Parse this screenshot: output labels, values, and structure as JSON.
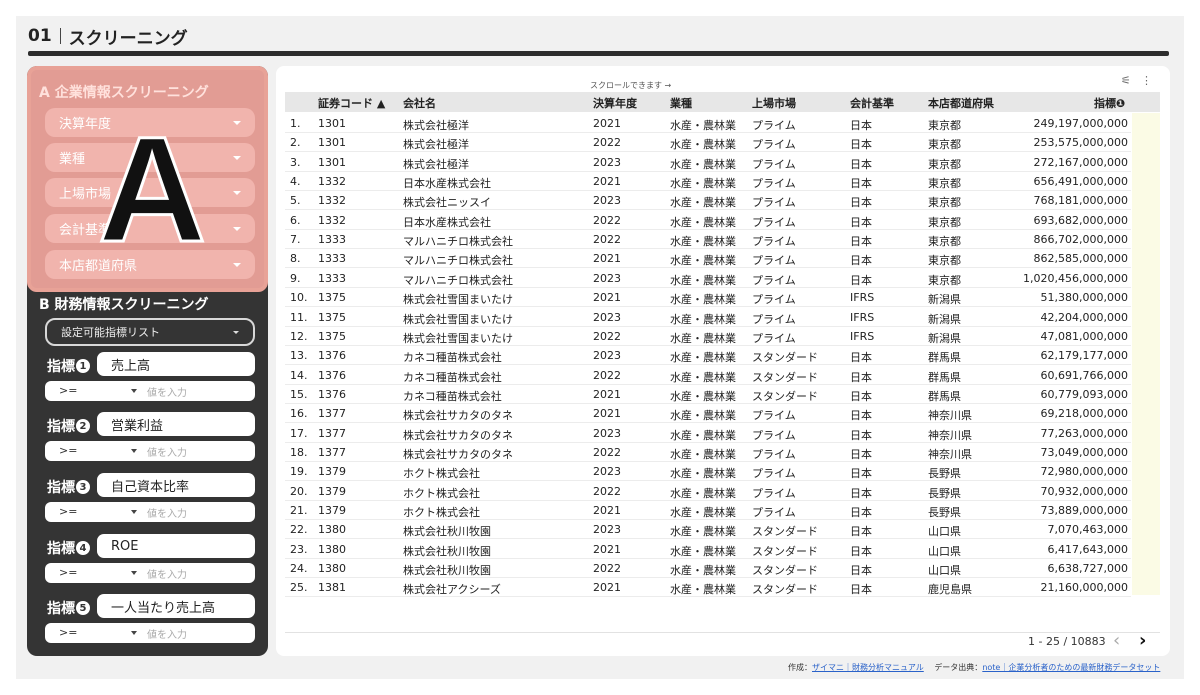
{
  "header": {
    "number": "01",
    "title": "スクリーニング"
  },
  "section_a": {
    "title": "A 企業情報スクリーニング",
    "filters": [
      "決算年度",
      "業種",
      "上場市場",
      "会計基準",
      "本店都道府県"
    ],
    "overlay_letter": "A"
  },
  "section_b": {
    "title": "B 財務情報スクリーニング",
    "list_label": "設定可能指標リスト",
    "metric_prefix": "指標",
    "metrics": [
      {
        "num": "1",
        "name": "売上高",
        "op": ">=",
        "placeholder": "値を入力"
      },
      {
        "num": "2",
        "name": "営業利益",
        "op": ">=",
        "placeholder": "値を入力"
      },
      {
        "num": "3",
        "name": "自己資本比率",
        "op": ">=",
        "placeholder": "値を入力"
      },
      {
        "num": "4",
        "name": "ROE",
        "op": ">=",
        "placeholder": "値を入力"
      },
      {
        "num": "5",
        "name": "一人当たり売上高",
        "op": ">=",
        "placeholder": "値を入力"
      }
    ]
  },
  "table": {
    "scroll_hint": "スクロールできます →",
    "toolbar": {
      "filter_icon": "filter-settings-icon",
      "more_icon": "more-vert-icon"
    },
    "columns": {
      "code": "証券コード ▲",
      "company": "会社名",
      "year": "決算年度",
      "industry": "業種",
      "market": "上場市場",
      "standard": "会計基準",
      "prefecture": "本店都道府県",
      "metric": "指標❶"
    },
    "rows": [
      [
        "1.",
        "1301",
        "株式会社極洋",
        "2021",
        "水産・農林業",
        "プライム",
        "日本",
        "東京都",
        "249,197,000,000"
      ],
      [
        "2.",
        "1301",
        "株式会社極洋",
        "2022",
        "水産・農林業",
        "プライム",
        "日本",
        "東京都",
        "253,575,000,000"
      ],
      [
        "3.",
        "1301",
        "株式会社極洋",
        "2023",
        "水産・農林業",
        "プライム",
        "日本",
        "東京都",
        "272,167,000,000"
      ],
      [
        "4.",
        "1332",
        "日本水産株式会社",
        "2021",
        "水産・農林業",
        "プライム",
        "日本",
        "東京都",
        "656,491,000,000"
      ],
      [
        "5.",
        "1332",
        "株式会社ニッスイ",
        "2023",
        "水産・農林業",
        "プライム",
        "日本",
        "東京都",
        "768,181,000,000"
      ],
      [
        "6.",
        "1332",
        "日本水産株式会社",
        "2022",
        "水産・農林業",
        "プライム",
        "日本",
        "東京都",
        "693,682,000,000"
      ],
      [
        "7.",
        "1333",
        "マルハニチロ株式会社",
        "2022",
        "水産・農林業",
        "プライム",
        "日本",
        "東京都",
        "866,702,000,000"
      ],
      [
        "8.",
        "1333",
        "マルハニチロ株式会社",
        "2021",
        "水産・農林業",
        "プライム",
        "日本",
        "東京都",
        "862,585,000,000"
      ],
      [
        "9.",
        "1333",
        "マルハニチロ株式会社",
        "2023",
        "水産・農林業",
        "プライム",
        "日本",
        "東京都",
        "1,020,456,000,000"
      ],
      [
        "10.",
        "1375",
        "株式会社雪国まいたけ",
        "2021",
        "水産・農林業",
        "プライム",
        "IFRS",
        "新潟県",
        "51,380,000,000"
      ],
      [
        "11.",
        "1375",
        "株式会社雪国まいたけ",
        "2023",
        "水産・農林業",
        "プライム",
        "IFRS",
        "新潟県",
        "42,204,000,000"
      ],
      [
        "12.",
        "1375",
        "株式会社雪国まいたけ",
        "2022",
        "水産・農林業",
        "プライム",
        "IFRS",
        "新潟県",
        "47,081,000,000"
      ],
      [
        "13.",
        "1376",
        "カネコ種苗株式会社",
        "2023",
        "水産・農林業",
        "スタンダード",
        "日本",
        "群馬県",
        "62,179,177,000"
      ],
      [
        "14.",
        "1376",
        "カネコ種苗株式会社",
        "2022",
        "水産・農林業",
        "スタンダード",
        "日本",
        "群馬県",
        "60,691,766,000"
      ],
      [
        "15.",
        "1376",
        "カネコ種苗株式会社",
        "2021",
        "水産・農林業",
        "スタンダード",
        "日本",
        "群馬県",
        "60,779,093,000"
      ],
      [
        "16.",
        "1377",
        "株式会社サカタのタネ",
        "2021",
        "水産・農林業",
        "プライム",
        "日本",
        "神奈川県",
        "69,218,000,000"
      ],
      [
        "17.",
        "1377",
        "株式会社サカタのタネ",
        "2023",
        "水産・農林業",
        "プライム",
        "日本",
        "神奈川県",
        "77,263,000,000"
      ],
      [
        "18.",
        "1377",
        "株式会社サカタのタネ",
        "2022",
        "水産・農林業",
        "プライム",
        "日本",
        "神奈川県",
        "73,049,000,000"
      ],
      [
        "19.",
        "1379",
        "ホクト株式会社",
        "2023",
        "水産・農林業",
        "プライム",
        "日本",
        "長野県",
        "72,980,000,000"
      ],
      [
        "20.",
        "1379",
        "ホクト株式会社",
        "2022",
        "水産・農林業",
        "プライム",
        "日本",
        "長野県",
        "70,932,000,000"
      ],
      [
        "21.",
        "1379",
        "ホクト株式会社",
        "2021",
        "水産・農林業",
        "プライム",
        "日本",
        "長野県",
        "73,889,000,000"
      ],
      [
        "22.",
        "1380",
        "株式会社秋川牧園",
        "2023",
        "水産・農林業",
        "スタンダード",
        "日本",
        "山口県",
        "7,070,463,000"
      ],
      [
        "23.",
        "1380",
        "株式会社秋川牧園",
        "2021",
        "水産・農林業",
        "スタンダード",
        "日本",
        "山口県",
        "6,417,643,000"
      ],
      [
        "24.",
        "1380",
        "株式会社秋川牧園",
        "2022",
        "水産・農林業",
        "スタンダード",
        "日本",
        "山口県",
        "6,638,727,000"
      ],
      [
        "25.",
        "1381",
        "株式会社アクシーズ",
        "2021",
        "水産・農林業",
        "スタンダード",
        "日本",
        "鹿児島県",
        "21,160,000,000"
      ]
    ],
    "pagination": {
      "range": "1 - 25 / 10883",
      "prev": "‹",
      "next": "›"
    }
  },
  "footer": {
    "made_by_label": "作成：",
    "made_by_link": "ザイマニ｜財務分析マニュアル",
    "source_label": "データ出典：",
    "source_link": "note｜企業分析者のための最新財務データセット"
  },
  "colors": {
    "section_a_bg": "#e29c94",
    "sidebar_bg": "#343434",
    "header_rule": "#2d2d2d",
    "link": "#2a62c9",
    "metric_column_highlight": "#fbfbe5"
  }
}
